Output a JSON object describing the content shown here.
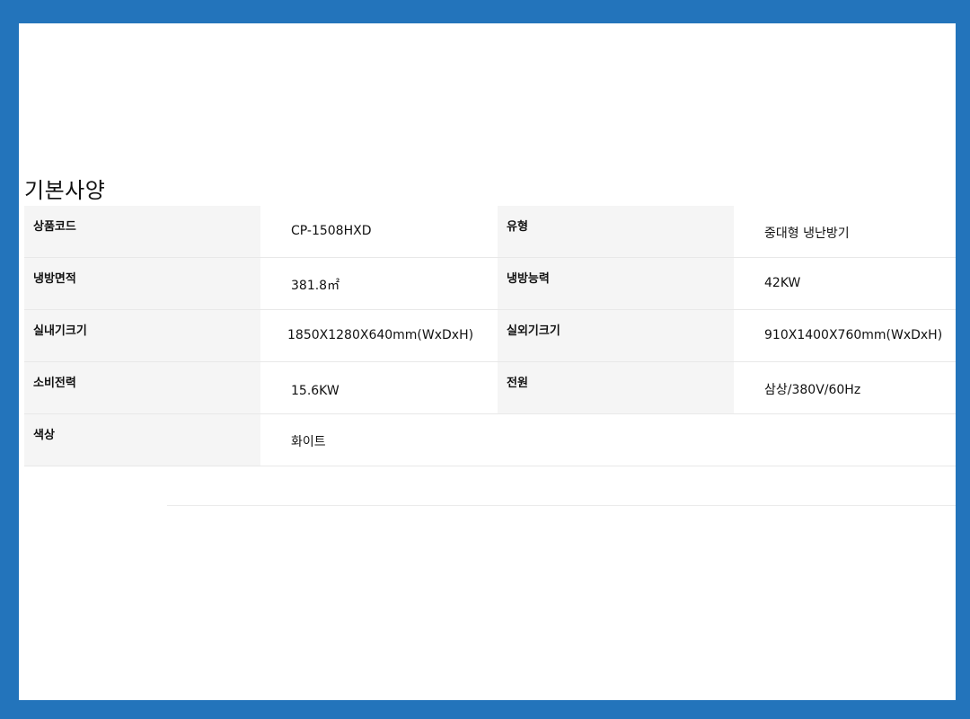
{
  "section": {
    "title": "기본사양"
  },
  "specs": {
    "rows": [
      {
        "label1": "상품코드",
        "value1": "CP-1508HXD",
        "label2": "유형",
        "value2": "중대형 냉난방기"
      },
      {
        "label1": "냉방면적",
        "value1": "381.8㎡",
        "label2": "냉방능력",
        "value2": "42KW"
      },
      {
        "label1": "실내기크기",
        "value1": "1850X1280X640mm(WxDxH)",
        "label2": "실외기크기",
        "value2": "910X1400X760mm(WxDxH)"
      },
      {
        "label1": "소비전력",
        "value1": "15.6KW",
        "label2": "전원",
        "value2": "삼상/380V/60Hz"
      },
      {
        "label1": "색상",
        "value1": "화이트"
      }
    ]
  }
}
